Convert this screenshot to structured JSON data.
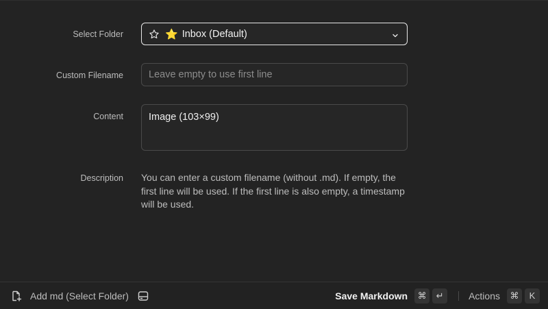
{
  "form": {
    "folder": {
      "label": "Select Folder",
      "emoji": "⭐",
      "value": "Inbox (Default)"
    },
    "filename": {
      "label": "Custom Filename",
      "placeholder": "Leave empty to use first line"
    },
    "content": {
      "label": "Content",
      "value": "Image (103×99)"
    },
    "description": {
      "label": "Description",
      "text": "You can enter a custom filename (without .md). If empty, the first line will be used. If the first line is also empty, a timestamp will be used."
    }
  },
  "footer": {
    "title": "Add md (Select Folder)",
    "primary_action": "Save Markdown",
    "primary_shortcut": [
      "⌘",
      "↵"
    ],
    "actions_label": "Actions",
    "actions_shortcut": [
      "⌘",
      "K"
    ]
  }
}
